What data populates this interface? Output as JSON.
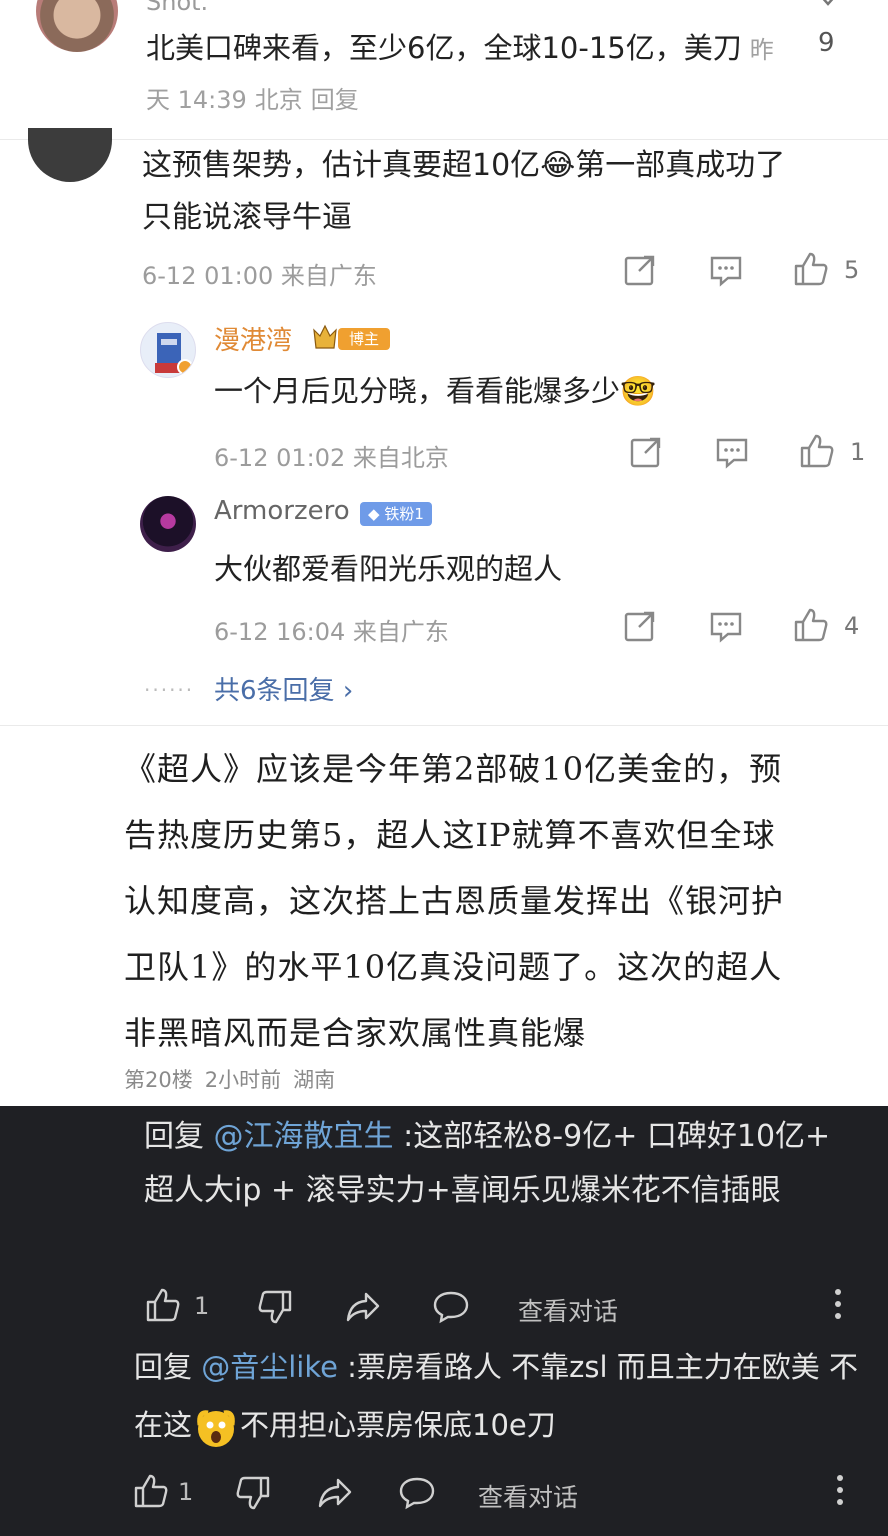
{
  "panel1": {
    "username": "Shot.",
    "body": "北美口碑来看，至少6亿，全球10-15亿，美刀",
    "time": "昨天 14:39",
    "location": "北京",
    "reply_label": "回复",
    "like_count": "9"
  },
  "panel2": {
    "main_comment": {
      "text_line1": "这预售架势，估计真要超10亿",
      "emoji": "😂",
      "text_line1_tail": "第一部真成功了",
      "text_line2": "只能说滚导牛逼",
      "date": "6-12 01:00",
      "location": "来自广东",
      "like_count": "5"
    },
    "replies": [
      {
        "username": "漫港湾",
        "badge": "博主",
        "text": "一个月后见分晓，看看能爆多少",
        "emoji": "🤓",
        "date": "6-12 01:02",
        "location": "来自北京",
        "like_count": "1"
      },
      {
        "username": "Armorzero",
        "badge": "铁粉1",
        "text": "大伙都爱看阳光乐观的超人",
        "date": "6-12 16:04",
        "location": "来自广东",
        "like_count": "4"
      }
    ],
    "more_link": "共6条回复",
    "more_dots": "······"
  },
  "panel3": {
    "lines": [
      "《超人》应该是今年第2部破10亿美金的，预",
      "告热度历史第5，超人这IP就算不喜欢但全球",
      "认知度高，这次搭上古恩质量发挥出《银河护",
      "卫队1》的水平10亿真没问题了。这次的超人",
      "非黑暗风而是合家欢属性真能爆"
    ],
    "floor": "第20楼",
    "time": "2小时前",
    "location": "湖南"
  },
  "panel4": {
    "reply1": {
      "prefix": "回复 ",
      "mention": "@江海散宜生",
      "text": " :这部轻松8-9亿+ 口碑好10亿+ 超人大ip + 滚导实力+喜闻乐见爆米花不信插眼",
      "like_count": "1",
      "view_label": "查看对话"
    },
    "reply2": {
      "prefix": "回复 ",
      "mention": "@音尘like",
      "text_a": " :票房看路人 不靠zsl 而且主力在欧美 不在这",
      "text_b": "不用担心票房保底10e刀",
      "like_count": "1",
      "view_label": "查看对话"
    }
  },
  "colors": {
    "orange_name": "#e08a36",
    "link_blue": "#4a6ea8",
    "mention_blue": "#6fa4d6",
    "dark_bg": "#1f2024"
  },
  "icons": [
    "like-icon",
    "share-icon",
    "comment-icon",
    "dislike-icon",
    "reply-icon",
    "more-icon"
  ]
}
